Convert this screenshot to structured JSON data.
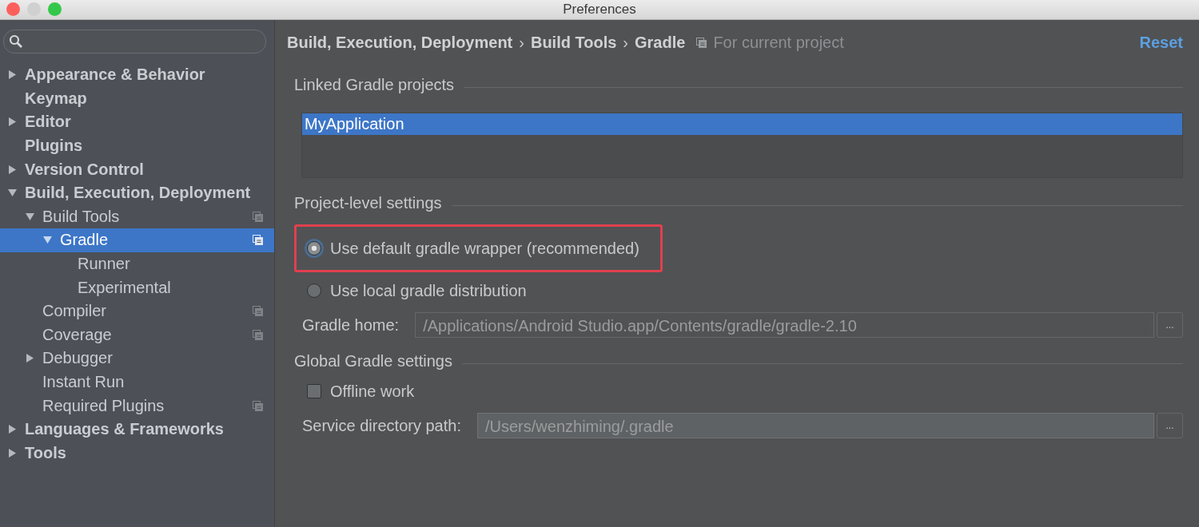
{
  "window": {
    "title": "Preferences"
  },
  "sidebar": {
    "tree": [
      {
        "label": "Appearance & Behavior",
        "expanded": false,
        "selected": false
      },
      {
        "label": "Keymap",
        "selected": false
      },
      {
        "label": "Editor",
        "expanded": false,
        "selected": false
      },
      {
        "label": "Plugins",
        "selected": false
      },
      {
        "label": "Version Control",
        "expanded": false,
        "selected": false
      },
      {
        "label": "Build, Execution, Deployment",
        "expanded": true,
        "selected": false,
        "children": [
          {
            "label": "Build Tools",
            "expanded": true,
            "selected": false,
            "project_scoped": true,
            "children": [
              {
                "label": "Gradle",
                "expanded": true,
                "selected": true,
                "project_scoped": true,
                "children": [
                  {
                    "label": "Runner",
                    "selected": false
                  },
                  {
                    "label": "Experimental",
                    "selected": false
                  }
                ]
              }
            ]
          },
          {
            "label": "Compiler",
            "selected": false,
            "project_scoped": true
          },
          {
            "label": "Coverage",
            "selected": false,
            "project_scoped": true
          },
          {
            "label": "Debugger",
            "expanded": false,
            "selected": false
          },
          {
            "label": "Instant Run",
            "selected": false
          },
          {
            "label": "Required Plugins",
            "selected": false,
            "project_scoped": true
          }
        ]
      },
      {
        "label": "Languages & Frameworks",
        "expanded": false,
        "selected": false
      },
      {
        "label": "Tools",
        "expanded": false,
        "selected": false
      }
    ]
  },
  "header": {
    "breadcrumb": [
      "Build, Execution, Deployment",
      "Build Tools",
      "Gradle"
    ],
    "separators": [
      "›",
      "›"
    ],
    "scope": "For current project",
    "reset": "Reset"
  },
  "sections": [
    {
      "title": "Linked Gradle projects",
      "items": [
        {
          "kind": "list",
          "rows": [
            {
              "label": "MyApplication",
              "selected": true
            }
          ]
        }
      ]
    },
    {
      "title": "Project-level settings",
      "items": [
        {
          "kind": "radio",
          "label": "Use default gradle wrapper (recommended)",
          "selected": true,
          "highlighted": true
        },
        {
          "kind": "radio",
          "label": "Use local gradle distribution",
          "selected": false,
          "highlighted": false
        },
        {
          "kind": "field",
          "label": "Gradle home:",
          "value": "/Applications/Android Studio.app/Contents/gradle/gradle-2.10",
          "disabled": false,
          "button": "..."
        }
      ]
    },
    {
      "title": "Global Gradle settings",
      "items": [
        {
          "kind": "checkbox",
          "label": "Offline work",
          "checked": false
        },
        {
          "kind": "field",
          "label": "Service directory path:",
          "value": "/Users/wenzhiming/.gradle",
          "disabled": true,
          "button": "..."
        }
      ]
    }
  ]
}
